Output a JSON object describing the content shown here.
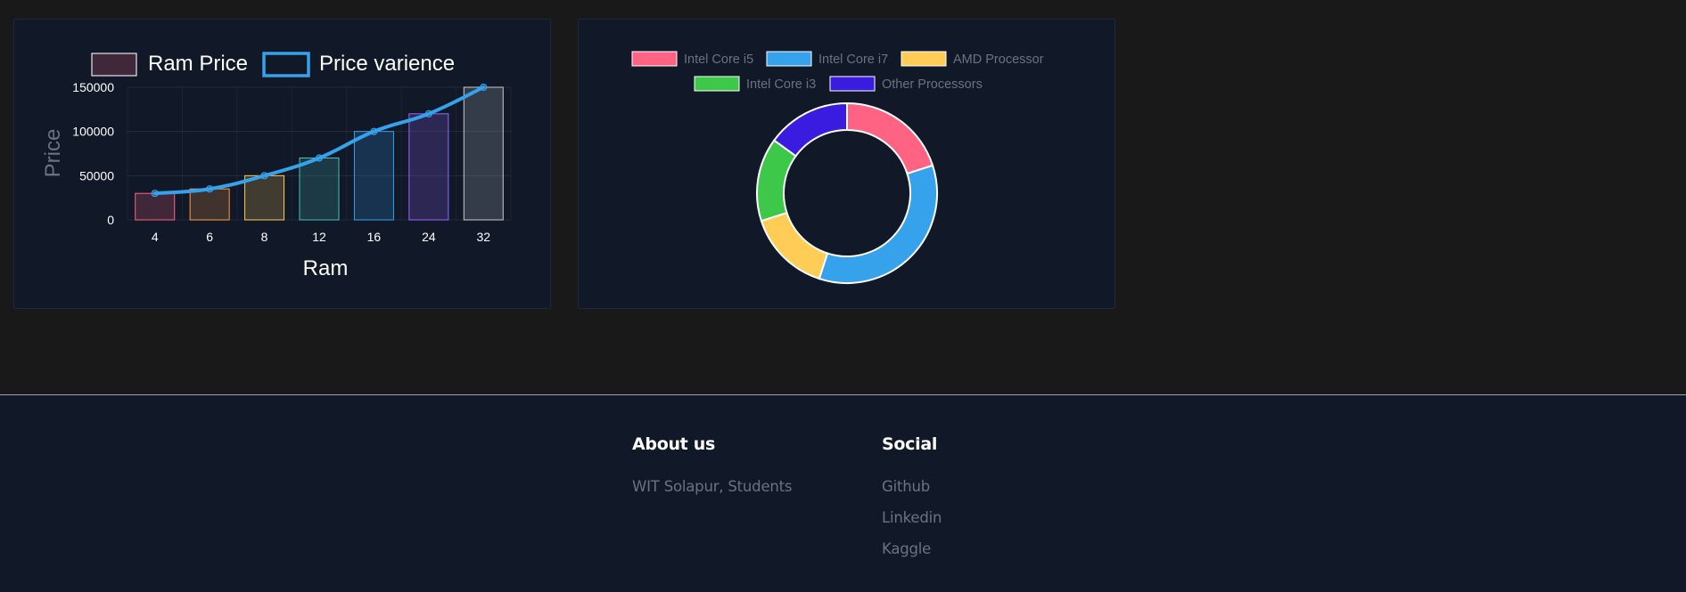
{
  "chart_data": [
    {
      "type": "bar",
      "categories": [
        "4",
        "6",
        "8",
        "12",
        "16",
        "24",
        "32"
      ],
      "series": [
        {
          "name": "Ram Price",
          "type": "bar",
          "values": [
            30000,
            35000,
            50000,
            70000,
            100000,
            120000,
            150000
          ]
        },
        {
          "name": "Price varience",
          "type": "line",
          "values": [
            30000,
            35000,
            50000,
            70000,
            100000,
            120000,
            150000
          ]
        }
      ],
      "bar_colors": [
        "#ff6384",
        "#ff9f40",
        "#ffcd56",
        "#4bc0c0",
        "#36a2eb",
        "#9966ff",
        "#c9cbcf"
      ],
      "line_color": "#36a2eb",
      "xlabel": "Ram",
      "ylabel": "Price",
      "ylim": [
        0,
        150000
      ],
      "yticks": [
        "0",
        "50000",
        "100000",
        "150000"
      ],
      "legend": "top",
      "grid": true
    },
    {
      "type": "pie",
      "donut": true,
      "labels": [
        "Intel Core i5",
        "Intel Core i7",
        "AMD Processor",
        "Intel Core i3",
        "Other Processors"
      ],
      "values": [
        20,
        35,
        15,
        15,
        15
      ],
      "colors": [
        "#ff6384",
        "#36a2eb",
        "#ffcd56",
        "#3ec84a",
        "#3a1be0"
      ],
      "legend": "top"
    }
  ],
  "footer": {
    "about": {
      "heading": "About us",
      "text": "WIT Solapur, Students"
    },
    "social": {
      "heading": "Social",
      "links": [
        "Github",
        "Linkedin",
        "Kaggle"
      ]
    }
  }
}
